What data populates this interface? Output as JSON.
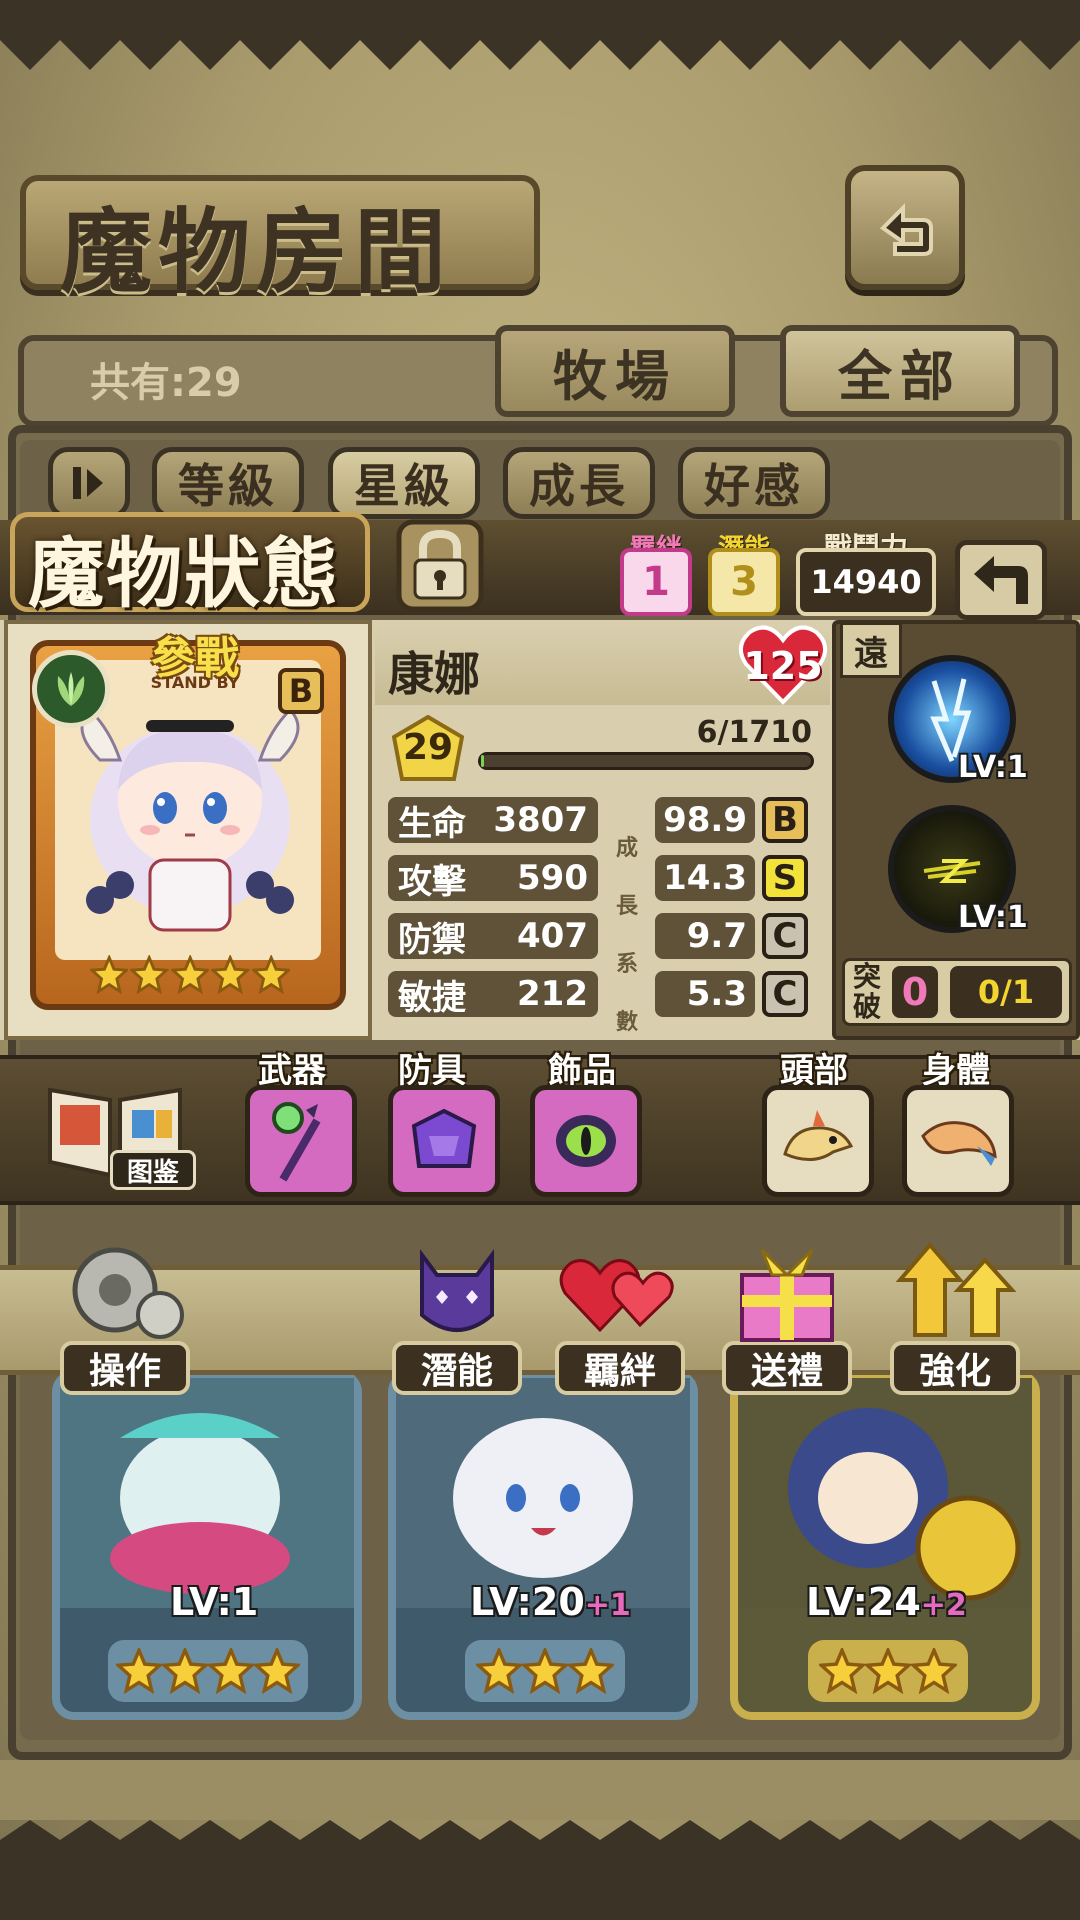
{
  "header": {
    "title": "魔物房間"
  },
  "tabs": {
    "count_label": "共有:29",
    "ranch": "牧場",
    "all": "全部"
  },
  "sort": {
    "order_icon": "sort-order-icon",
    "level": "等級",
    "star": "星級",
    "growth": "成長",
    "affinity": "好感"
  },
  "status": {
    "title": "魔物狀態",
    "bond_label": "羈絆",
    "bond_value": "1",
    "potential_label": "潛能",
    "potential_value": "3",
    "power_label": "戰鬥力",
    "power_value": "14940"
  },
  "monster": {
    "name": "康娜",
    "heart_value": "125",
    "deploy_label": "參戰",
    "deploy_sub": "STAND BY",
    "rank_badge": "B",
    "level": "29",
    "exp": "6/1710",
    "exp_fraction": 0.0035,
    "stars": 5,
    "stats": [
      {
        "label": "生命",
        "value": "3807",
        "growth": "98.9",
        "grade": "B"
      },
      {
        "label": "攻擊",
        "value": "590",
        "growth": "14.3",
        "grade": "S"
      },
      {
        "label": "防禦",
        "value": "407",
        "growth": "9.7",
        "grade": "C"
      },
      {
        "label": "敏捷",
        "value": "212",
        "growth": "5.3",
        "grade": "C"
      }
    ],
    "growth_chars": [
      "成",
      "長",
      "系",
      "數"
    ]
  },
  "skills": {
    "range": "遠",
    "skill1_level": "LV:1",
    "skill2_level": "LV:1",
    "breakthrough_label_1": "突",
    "breakthrough_label_2": "破",
    "breakthrough_value": "0",
    "breakthrough_progress": "0/1"
  },
  "equipment": {
    "book_label": "图鉴",
    "weapon": "武器",
    "armor": "防具",
    "accessory": "飾品",
    "head": "頭部",
    "body": "身體"
  },
  "actions": {
    "operate": "操作",
    "potential": "潛能",
    "bond": "羈絆",
    "gift": "送禮",
    "enhance": "強化"
  },
  "cards": [
    {
      "level": "LV:1",
      "bonus": "",
      "stars": 4
    },
    {
      "level": "LV:20",
      "bonus": "+1",
      "stars": 3
    },
    {
      "level": "LV:24",
      "bonus": "+2",
      "stars": 3
    }
  ],
  "colors": {
    "heart": "#d8283a",
    "potential_badge": "#f2d530",
    "bond_badge": "#f07ab8",
    "active_pink": "#d46bc0"
  }
}
